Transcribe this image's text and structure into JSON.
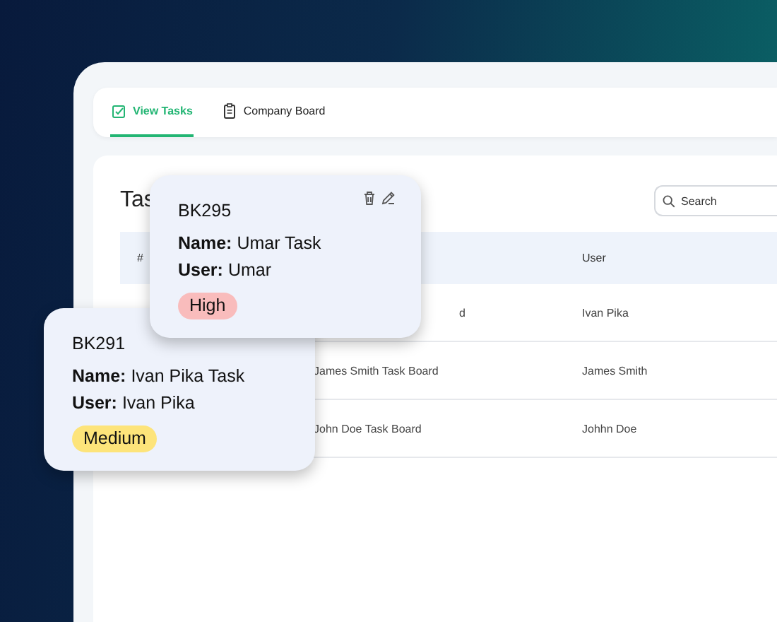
{
  "tabs": [
    {
      "label": "View Tasks",
      "selected": true
    },
    {
      "label": "Company Board",
      "selected": false
    }
  ],
  "tasks_panel": {
    "title": "Tas",
    "search": {
      "placeholder": "Search"
    },
    "table": {
      "header": {
        "id": "#",
        "user": "User"
      },
      "rows": [
        {
          "name": "d",
          "user": "Ivan Pika"
        },
        {
          "name": "James Smith Task Board",
          "user": "James Smith"
        },
        {
          "name": "John Doe Task Board",
          "user": "Johhn Doe"
        }
      ]
    }
  },
  "task_cards": [
    {
      "code": "BK295",
      "name_label": "Name:",
      "name": "Umar Task",
      "user_label": "User:",
      "user": "Umar",
      "priority": "High",
      "color": "#f9bcbc",
      "actions": true
    },
    {
      "code": "BK291",
      "name_label": "Name:",
      "name": "Ivan Pika Task",
      "user_label": "User:",
      "user": "Ivan Pika",
      "priority": "Medium",
      "color": "#fde47a"
    }
  ]
}
